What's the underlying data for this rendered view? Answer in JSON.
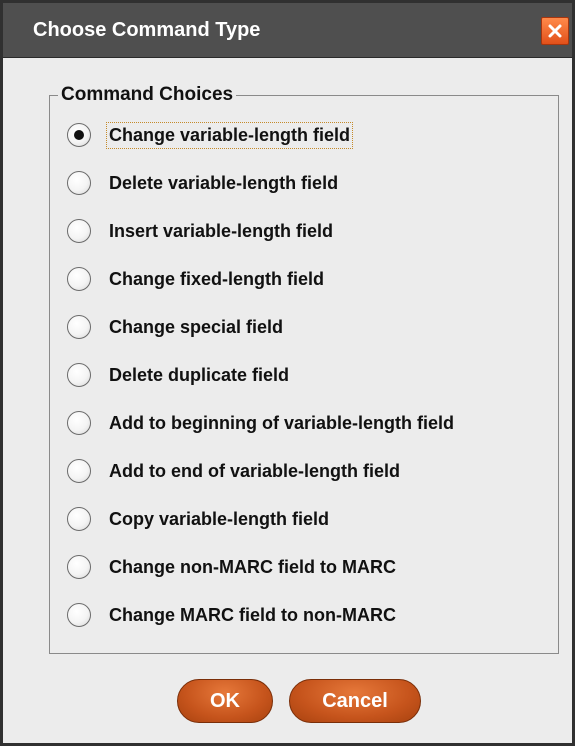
{
  "dialog": {
    "title": "Choose Command Type",
    "close_icon": "close-icon"
  },
  "group": {
    "legend": "Command Choices",
    "options": [
      {
        "label": "Change variable-length field",
        "selected": true
      },
      {
        "label": "Delete variable-length field",
        "selected": false
      },
      {
        "label": "Insert variable-length field",
        "selected": false
      },
      {
        "label": "Change fixed-length field",
        "selected": false
      },
      {
        "label": "Change special field",
        "selected": false
      },
      {
        "label": "Delete duplicate field",
        "selected": false
      },
      {
        "label": "Add to beginning of variable-length field",
        "selected": false
      },
      {
        "label": "Add to end of variable-length field",
        "selected": false
      },
      {
        "label": "Copy variable-length field",
        "selected": false
      },
      {
        "label": "Change non-MARC field to MARC",
        "selected": false
      },
      {
        "label": "Change MARC field to non-MARC",
        "selected": false
      }
    ]
  },
  "buttons": {
    "ok_label": "OK",
    "cancel_label": "Cancel"
  },
  "colors": {
    "titlebar": "#4f4f4f",
    "button_accent": "#c6541c",
    "close_button": "#e2501a"
  }
}
